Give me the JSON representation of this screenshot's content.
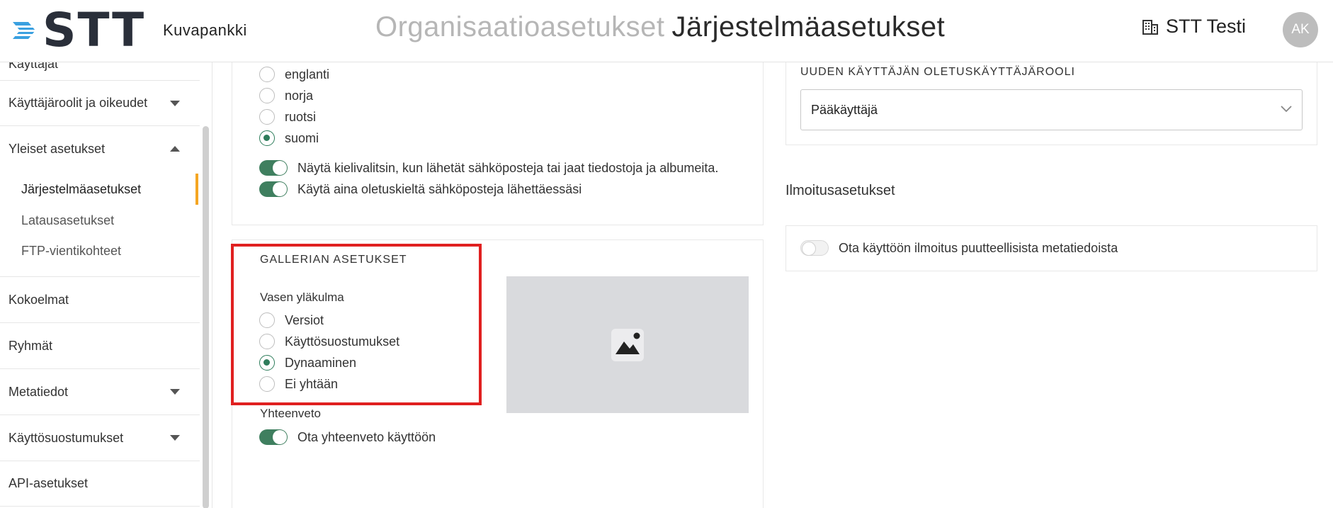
{
  "header": {
    "logo_text": "STT",
    "logo_sub": "Kuvapankki",
    "crumb_parent": "Organisaatioasetukset",
    "crumb_current": "Järjestelmäasetukset",
    "org_name": "STT Testi",
    "avatar_initials": "AK"
  },
  "sidebar": {
    "top_partial": "Käyttäjät",
    "roles": "Käyttäjäroolit ja oikeudet",
    "general": "Yleiset asetukset",
    "sub_system": "Järjestelmäasetukset",
    "sub_upload": "Latausasetukset",
    "sub_ftp": "FTP-vientikohteet",
    "collections": "Kokoelmat",
    "groups": "Ryhmät",
    "metadata": "Metatiedot",
    "consents": "Käyttösuostumukset",
    "api": "API-asetukset"
  },
  "language": {
    "options": [
      "englanti",
      "norja",
      "ruotsi",
      "suomi"
    ],
    "selected": "suomi",
    "toggle1": "Näytä kielivalitsin, kun lähetät sähköposteja tai jaat tiedostoja ja albumeita.",
    "toggle2": "Käytä aina oletuskieltä sähköposteja lähettäessäsi"
  },
  "gallery": {
    "title": "GALLERIAN ASETUKSET",
    "corner_label": "Vasen yläkulma",
    "options": [
      "Versiot",
      "Käyttösuostumukset",
      "Dynaaminen",
      "Ei yhtään"
    ],
    "selected": "Dynaaminen",
    "summary_label": "Yhteenveto",
    "summary_toggle": "Ota yhteenveto käyttöön"
  },
  "role": {
    "caption": "UUDEN KÄYTTÄJÄN OLETUSKÄYTTÄJÄROOLI",
    "value": "Pääkäyttäjä"
  },
  "notifications": {
    "heading": "Ilmoitusasetukset",
    "toggle": "Ota käyttöön ilmoitus puutteellisista metatiedoista"
  },
  "colors": {
    "accent_green": "#2e7d5b",
    "active_marker": "#f5a623",
    "highlight_red": "#e02020"
  }
}
